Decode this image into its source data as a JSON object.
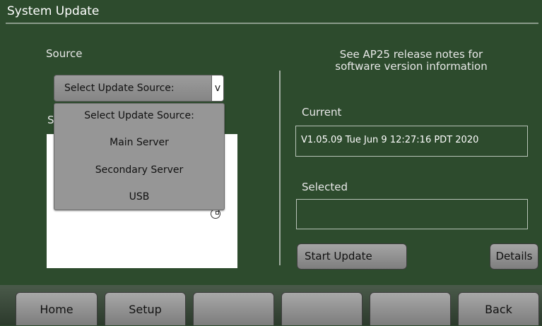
{
  "screen": {
    "title": "System Update"
  },
  "left": {
    "source_label": "Source",
    "select_value": "Select Update Source:",
    "select_arrow": "v",
    "partial_label": "S",
    "dropdown_options": [
      "Select Update Source:",
      "Main Server",
      "Secondary Server",
      "USB"
    ]
  },
  "right": {
    "notes_line1": "See AP25 release notes for",
    "notes_line2": "software version information",
    "current_label": "Current",
    "current_value": "V1.05.09 Tue Jun 9 12:27:16 PDT 2020",
    "selected_label": "Selected",
    "selected_value": "",
    "start_update_label": "Start Update",
    "details_label": "Details"
  },
  "nav": {
    "tabs": [
      "Home",
      "Setup",
      "",
      "",
      "",
      "Back"
    ]
  }
}
